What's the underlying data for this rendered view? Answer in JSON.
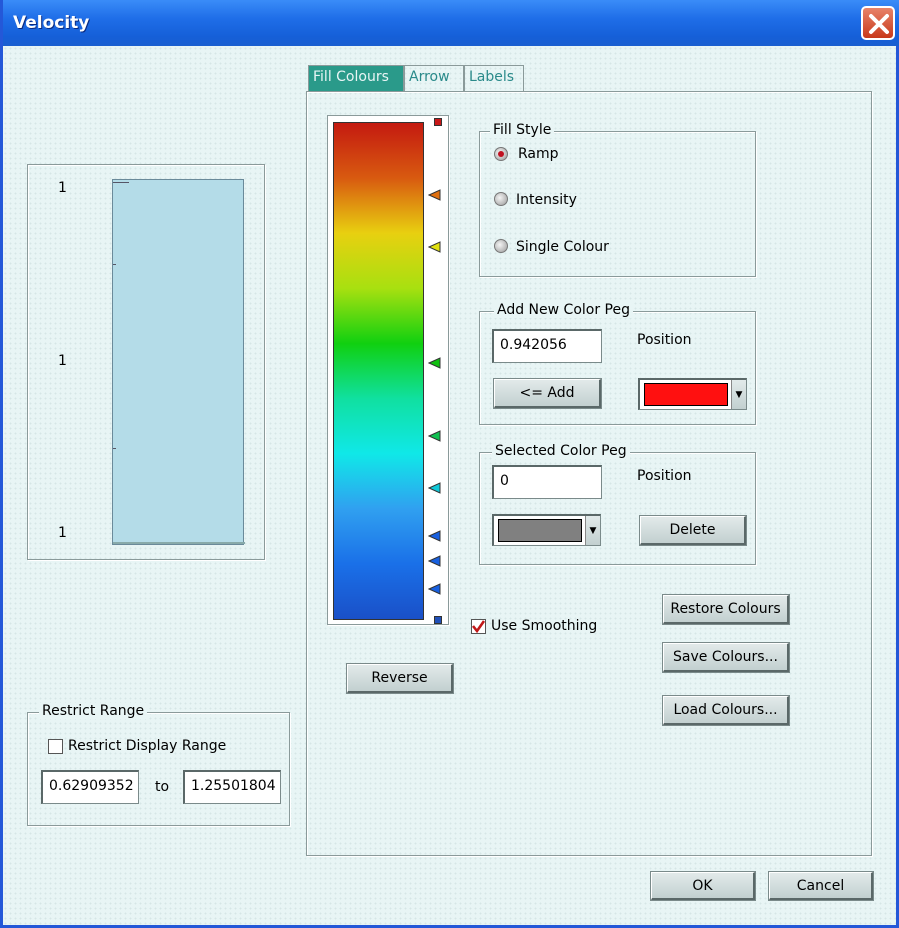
{
  "window": {
    "title": "Velocity"
  },
  "preview": {
    "labels": [
      "1",
      "1",
      "1"
    ],
    "fill_color": "#b4dce8"
  },
  "tabs": [
    {
      "label": "Fill Colours",
      "active": true
    },
    {
      "label": "Arrow",
      "active": false
    },
    {
      "label": "Labels",
      "active": false
    }
  ],
  "ramp": {
    "gradient_stops": [
      "#c41a10",
      "#d85a10",
      "#e8d010",
      "#a8e010",
      "#10d010",
      "#10e0a0",
      "#10e8e8",
      "#30a0f0",
      "#1a70e8",
      "#1a50c8"
    ],
    "pegs": [
      {
        "kind": "square",
        "color": "#c81818",
        "position": 1.0
      },
      {
        "kind": "triangle",
        "color": "#e07010",
        "position": 0.853
      },
      {
        "kind": "triangle",
        "color": "#e0e010",
        "position": 0.748
      },
      {
        "kind": "triangle",
        "color": "#10c010",
        "position": 0.517
      },
      {
        "kind": "triangle",
        "color": "#10c050",
        "position": 0.37
      },
      {
        "kind": "triangle",
        "color": "#10c8d8",
        "position": 0.265
      },
      {
        "kind": "triangle",
        "color": "#1860e0",
        "position": 0.168
      },
      {
        "kind": "triangle",
        "color": "#1860e0",
        "position": 0.118
      },
      {
        "kind": "triangle",
        "color": "#1860e0",
        "position": 0.063
      },
      {
        "kind": "square",
        "color": "#2050b8",
        "position": 0.0
      }
    ]
  },
  "fill_style": {
    "legend": "Fill Style",
    "options": [
      {
        "label": "Ramp",
        "selected": true
      },
      {
        "label": "Intensity",
        "selected": false
      },
      {
        "label": "Single Colour",
        "selected": false
      }
    ]
  },
  "add_peg": {
    "legend": "Add New Color Peg",
    "value": "0.942056",
    "position_label": "Position",
    "add_label": "<= Add",
    "color": "#ff1010"
  },
  "selected_peg": {
    "legend": "Selected Color Peg",
    "value": "0",
    "position_label": "Position",
    "color": "#808080",
    "delete_label": "Delete"
  },
  "use_smoothing": {
    "label": "Use Smoothing",
    "checked": true
  },
  "buttons": {
    "reverse": "Reverse",
    "restore": "Restore  Colours",
    "save": "Save Colours...",
    "load": "Load Colours...",
    "ok": "OK",
    "cancel": "Cancel"
  },
  "restrict": {
    "legend": "Restrict Range",
    "checkbox_label": "Restrict Display Range",
    "checked": false,
    "min": "0.62909352",
    "to_label": "to",
    "max": "1.25501804"
  }
}
